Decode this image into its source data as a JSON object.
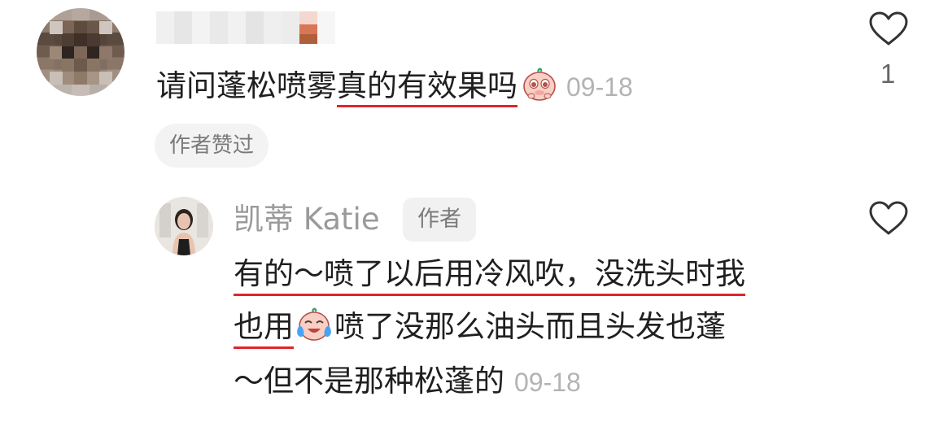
{
  "comment": {
    "text_plain": "请问蓬松喷雾",
    "text_underlined": "真的有效果吗",
    "emoji": "crying-face-emoji",
    "timestamp": "09-18",
    "chip": "作者赞过",
    "like_count": "1"
  },
  "reply": {
    "name": "凯蒂 Katie",
    "author_tag": "作者",
    "line1_underlined": "有的～喷了以后用冷风吹，没洗头时我",
    "line2_underlined": "也用",
    "line2_emoji": "laughing-tears-emoji",
    "line2_rest": "喷了没那么油头而且头发也蓬",
    "line3": "～但不是那种松蓬的",
    "timestamp": "09-18"
  },
  "colors": {
    "underline": "#e3242b",
    "timestamp": "#b3b3b3",
    "muted_text": "#9a9a9a"
  }
}
